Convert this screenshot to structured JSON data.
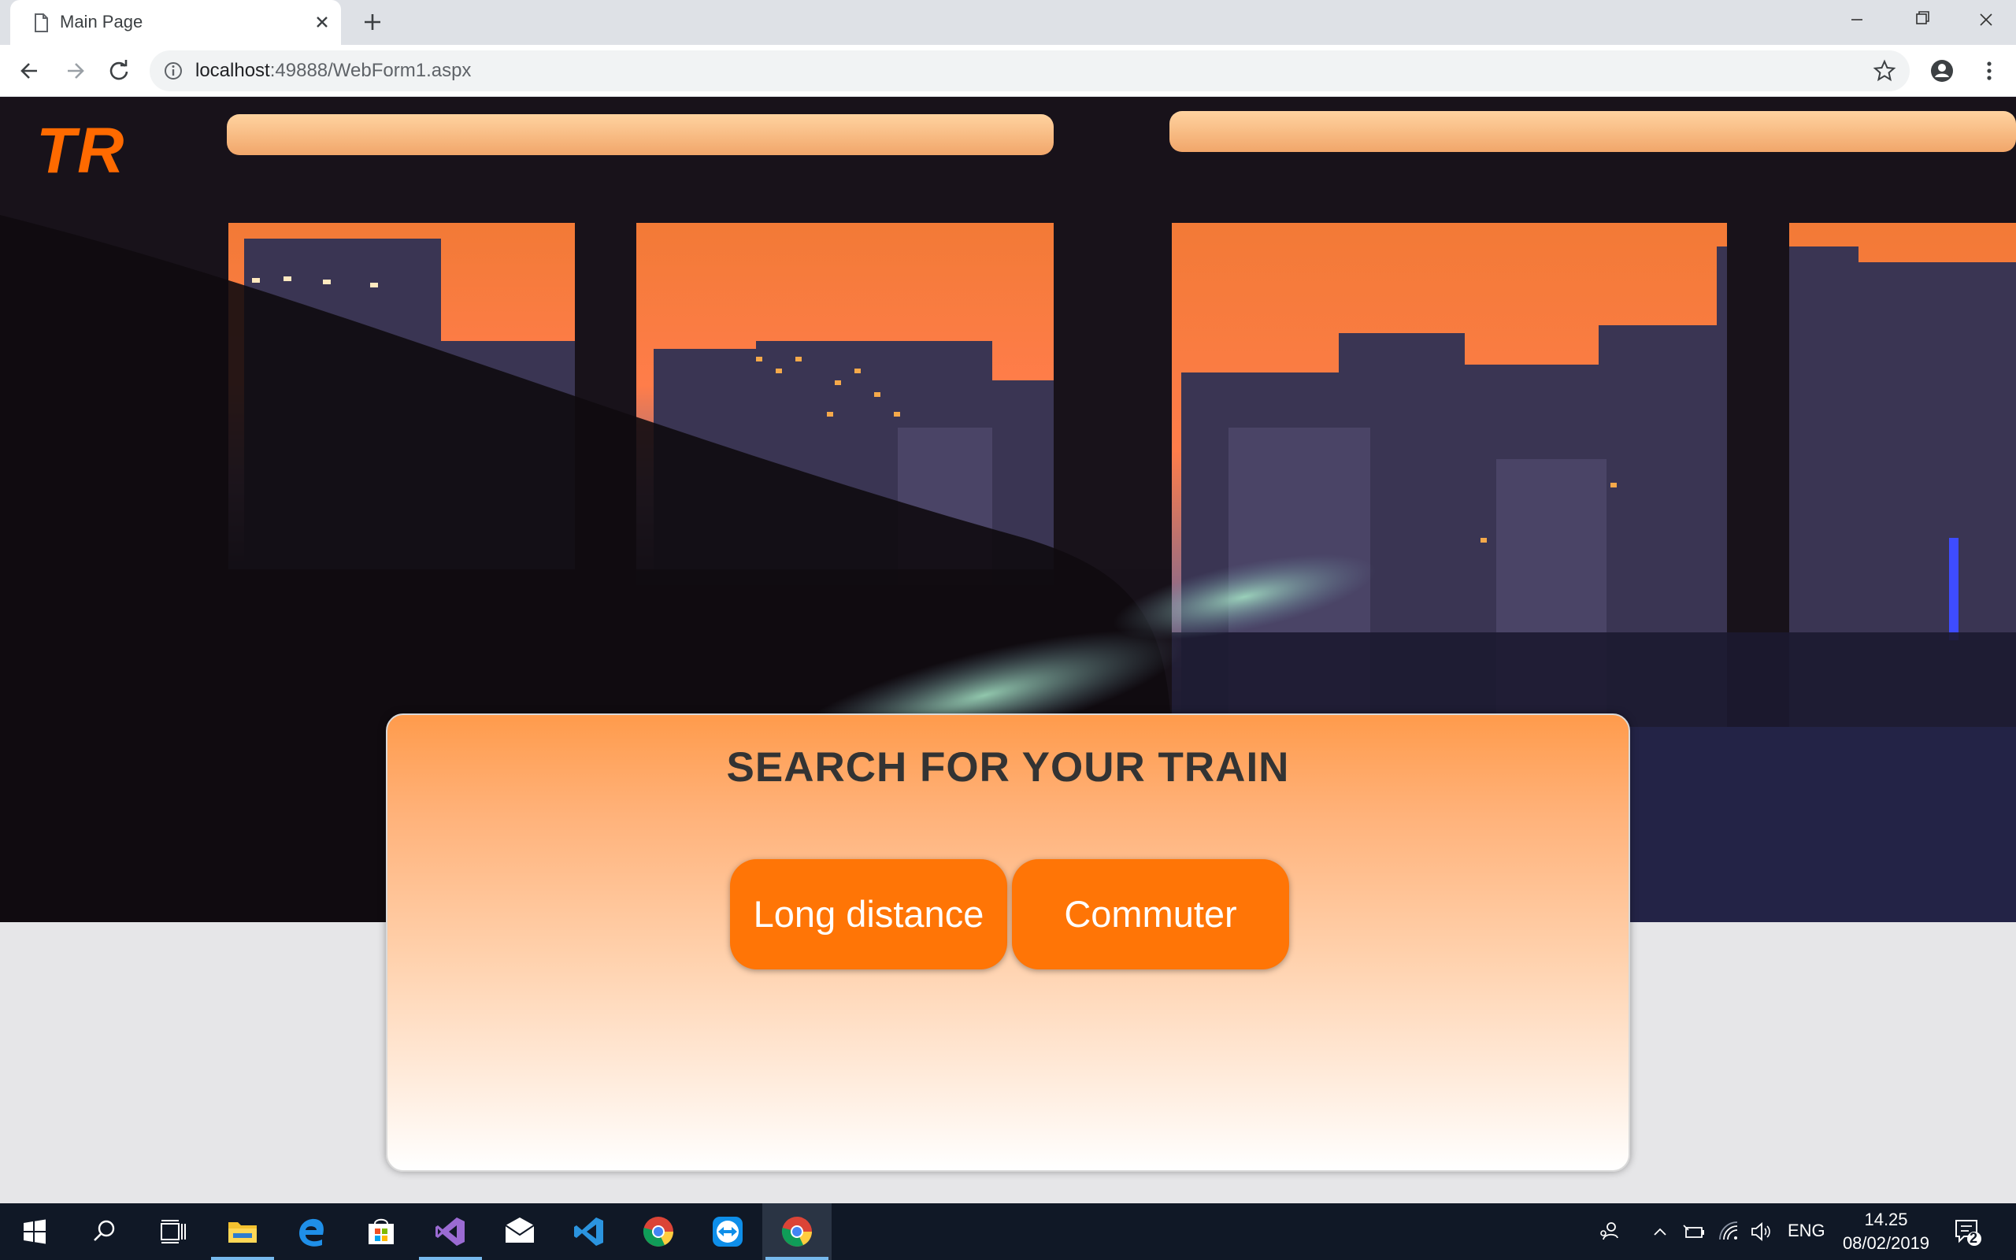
{
  "browser": {
    "tab_title": "Main Page",
    "url_host": "localhost",
    "url_rest": ":49888/WebForm1.aspx"
  },
  "page": {
    "logo": "TR",
    "search_title": "SEARCH FOR YOUR TRAIN",
    "buttons": {
      "long_distance": "Long distance",
      "commuter": "Commuter"
    }
  },
  "taskbar": {
    "language": "ENG",
    "time": "14.25",
    "date": "08/02/2019",
    "notification_count": "2"
  },
  "colors": {
    "accent": "#ff7506",
    "logo": "#ff6a00",
    "taskbar": "#101826"
  }
}
